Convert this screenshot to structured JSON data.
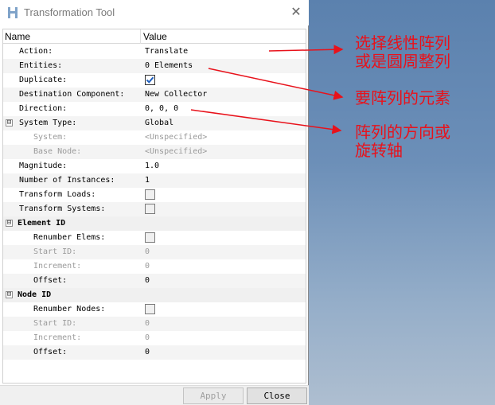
{
  "window": {
    "title": "Transformation Tool",
    "close_glyph": "✕"
  },
  "table": {
    "columns": {
      "name": "Name",
      "value": "Value"
    },
    "rows": [
      {
        "label": "Action:",
        "value": "Translate"
      },
      {
        "label": "Entities:",
        "value": "0 Elements"
      },
      {
        "label": "Duplicate:",
        "checked": true
      },
      {
        "label": "Destination Component:",
        "value": "New Collector"
      },
      {
        "label": "Direction:",
        "value": "0, 0, 0"
      },
      {
        "label": "System Type:",
        "value": "Global",
        "toggle": "⊟"
      },
      {
        "label": "System:",
        "value": "<Unspecified>"
      },
      {
        "label": "Base Node:",
        "value": "<Unspecified>"
      },
      {
        "label": "Magnitude:",
        "value": "1.0"
      },
      {
        "label": "Number of Instances:",
        "value": "1"
      },
      {
        "label": "Transform Loads:",
        "checked": false
      },
      {
        "label": "Transform Systems:",
        "checked": false
      },
      {
        "label": "Element ID",
        "toggle": "⊟"
      },
      {
        "label": "Renumber Elems:",
        "checked": false
      },
      {
        "label": "Start ID:",
        "value": "0"
      },
      {
        "label": "Increment:",
        "value": "0"
      },
      {
        "label": "Offset:",
        "value": "0"
      },
      {
        "label": "Node ID",
        "toggle": "⊟"
      },
      {
        "label": "Renumber Nodes:",
        "checked": false
      },
      {
        "label": "Start ID:",
        "value": "0"
      },
      {
        "label": "Increment:",
        "value": "0"
      },
      {
        "label": "Offset:",
        "value": "0"
      }
    ]
  },
  "footer": {
    "apply": "Apply",
    "close": "Close"
  },
  "annotations": {
    "a1_line1": "选择线性阵列",
    "a1_line2": "或是圆周整列",
    "a2": "要阵列的元素",
    "a3_line1": "阵列的方向或",
    "a3_line2": "旋转轴"
  },
  "colors": {
    "annotation": "#e8121b",
    "checkmark": "#1f5fbf"
  }
}
